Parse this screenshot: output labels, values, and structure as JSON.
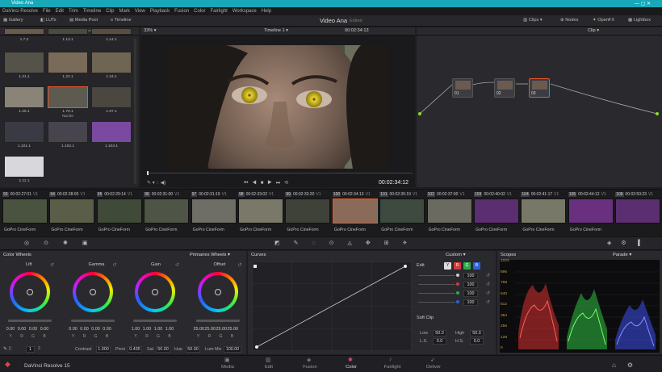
{
  "window_title": "Video Ana",
  "menu": [
    "DaVinci Resolve",
    "File",
    "Edit",
    "Trim",
    "Timeline",
    "Clip",
    "Mark",
    "View",
    "Playback",
    "Fusion",
    "Color",
    "Fairlight",
    "Workspace",
    "Help"
  ],
  "toolbar": {
    "gallery": "Gallery",
    "luts": "LUTs",
    "media_pool": "Media Pool",
    "timeline": "Timeline",
    "project_name": "Video Ana",
    "edited": "Edited",
    "clips": "Clips",
    "nodes": "Nodes",
    "openfx": "OpenFX",
    "lightbox": "Lightbox"
  },
  "viewer_bar": {
    "zoom": "33%",
    "timeline_name": "Timeline 1",
    "timecode": "00:02:34:13",
    "clip_mode": "Clip"
  },
  "gallery": {
    "stills": [
      {
        "label": "1.7.2"
      },
      {
        "label": "1.13.1"
      },
      {
        "label": "1.14.1"
      },
      {
        "label": "1.21.1"
      },
      {
        "label": "1.22.1"
      },
      {
        "label": "1.24.1"
      },
      {
        "label": "1.25.1"
      },
      {
        "label": "1.70.1"
      },
      {
        "label": "1.97.1"
      },
      {
        "label": "1.101.1"
      },
      {
        "label": "1.102.1"
      },
      {
        "label": "1.103.1"
      },
      {
        "label": "1.11.1"
      }
    ],
    "selected_caption": "Noche"
  },
  "transport": {
    "timecode": "00:02:34:12"
  },
  "nodes": [
    {
      "label": "01"
    },
    {
      "label": "02"
    },
    {
      "label": "03"
    }
  ],
  "clips": [
    {
      "num": "93",
      "tc": "00:02:27:01",
      "track": "V1"
    },
    {
      "num": "94",
      "tc": "00:02:28:05",
      "track": "V1"
    },
    {
      "num": "95",
      "tc": "00:02:29:14",
      "track": "V1"
    },
    {
      "num": "96",
      "tc": "00:02:31:00",
      "track": "V1"
    },
    {
      "num": "97",
      "tc": "00:02:31:19",
      "track": "V1"
    },
    {
      "num": "98",
      "tc": "00:02:33:02",
      "track": "V1"
    },
    {
      "num": "99",
      "tc": "00:02:33:20",
      "track": "V1"
    },
    {
      "num": "100",
      "tc": "00:02:34:13",
      "track": "V1"
    },
    {
      "num": "101",
      "tc": "00:02:35:19",
      "track": "V1"
    },
    {
      "num": "102",
      "tc": "00:02:37:00",
      "track": "V1"
    },
    {
      "num": "103",
      "tc": "00:02:40:02",
      "track": "V1"
    },
    {
      "num": "104",
      "tc": "00:02:41:17",
      "track": "V1"
    },
    {
      "num": "105",
      "tc": "00:02:44:12",
      "track": "V1"
    },
    {
      "num": "106",
      "tc": "00:02:50:23",
      "track": "V1"
    }
  ],
  "clip_format": "GoPro CineForm",
  "color_wheels": {
    "title": "Color Wheels",
    "mode": "Primaries Wheels",
    "wheels": [
      {
        "name": "Lift",
        "values": [
          "0.00",
          "0.00",
          "0.00",
          "0.00"
        ]
      },
      {
        "name": "Gamma",
        "values": [
          "0.00",
          "0.00",
          "0.00",
          "0.00"
        ]
      },
      {
        "name": "Gain",
        "values": [
          "1.00",
          "1.00",
          "1.00",
          "1.00"
        ]
      },
      {
        "name": "Offset",
        "values": [
          "25.00",
          "25.00",
          "25.00",
          "25.00"
        ]
      }
    ],
    "channels": [
      "Y",
      "R",
      "G",
      "B"
    ],
    "pages": [
      "1",
      "2"
    ],
    "adjust": {
      "contrast_label": "Contrast",
      "contrast": "1.000",
      "pivot_label": "Pivot",
      "pivot": "0.435",
      "sat_label": "Sat",
      "sat": "50.00",
      "hue_label": "Hue",
      "hue": "50.00",
      "lummix_label": "Lum Mix",
      "lummix": "100.00"
    }
  },
  "curves": {
    "title": "Curves",
    "mode": "Custom",
    "edit_label": "Edit",
    "intensities": [
      "100",
      "100",
      "100",
      "100"
    ],
    "soft_clip": {
      "title": "Soft Clip",
      "low_label": "Low",
      "low": "50.0",
      "high_label": "High",
      "high": "50.0",
      "ls_label": "L.S.",
      "ls": "0.0",
      "hs_label": "H.S.",
      "hs": "0.0"
    }
  },
  "scopes": {
    "title": "Scopes",
    "mode": "Parade",
    "scale": [
      "1023",
      "896",
      "768",
      "640",
      "512",
      "384",
      "256",
      "128",
      "0"
    ]
  },
  "page_tabs": [
    {
      "label": "Media"
    },
    {
      "label": "Edit"
    },
    {
      "label": "Fusion"
    },
    {
      "label": "Color"
    },
    {
      "label": "Fairlight"
    },
    {
      "label": "Deliver"
    }
  ],
  "app_name": "DaVinci Resolve 15",
  "colors": {
    "accent": "#18a8b8",
    "selected": "#e8562a",
    "red": "#d23a3a",
    "green": "#2fa84a",
    "blue": "#2e62d8"
  }
}
